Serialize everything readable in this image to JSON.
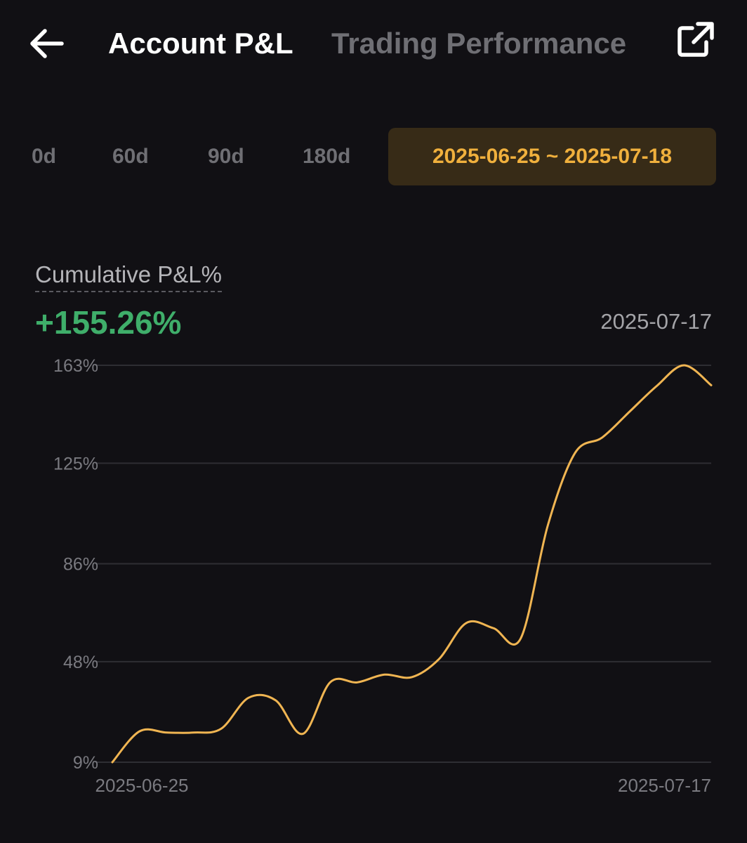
{
  "header": {
    "tabs": [
      {
        "label": "Account P&L",
        "active": true
      },
      {
        "label": "Trading Performance",
        "active": false
      }
    ],
    "back_icon": "arrow-left-icon",
    "share_icon": "external-link-icon"
  },
  "range": {
    "options": [
      "0d",
      "60d",
      "90d",
      "180d"
    ],
    "selected": "2025-06-25 ~ 2025-07-18"
  },
  "metric": {
    "label": "Cumulative P&L%",
    "value": "+155.26%",
    "date": "2025-07-17"
  },
  "colors": {
    "background": "#111014",
    "accent": "#f0b03d",
    "accent_bg": "#372b17",
    "positive": "#3fae6a",
    "line": "#f0b552",
    "grid": "#2e2e33",
    "muted": "#6f6f74"
  },
  "chart_data": {
    "type": "line",
    "x_start": "2025-06-25",
    "x_end": "2025-07-17",
    "x_tick_labels": [
      "2025-06-25",
      "2025-07-17"
    ],
    "y_tick_labels": [
      "163%",
      "125%",
      "86%",
      "48%",
      "9%"
    ],
    "y_ticks": [
      163,
      125,
      86,
      48,
      9
    ],
    "ylim": [
      9,
      163
    ],
    "grid": true,
    "series": [
      {
        "x": [
          "2025-06-25",
          "2025-06-26",
          "2025-06-27",
          "2025-06-28",
          "2025-06-29",
          "2025-06-30",
          "2025-07-01",
          "2025-07-02",
          "2025-07-03",
          "2025-07-04",
          "2025-07-05",
          "2025-07-06",
          "2025-07-07",
          "2025-07-08",
          "2025-07-09",
          "2025-07-10",
          "2025-07-11",
          "2025-07-12",
          "2025-07-13",
          "2025-07-14",
          "2025-07-15",
          "2025-07-16",
          "2025-07-17"
        ],
        "values": [
          9,
          21,
          20.5,
          20.5,
          22,
          34,
          33,
          20,
          40,
          40,
          43,
          42,
          49,
          63,
          61,
          57,
          101,
          129,
          135,
          145,
          155,
          163,
          155.26
        ]
      }
    ]
  }
}
